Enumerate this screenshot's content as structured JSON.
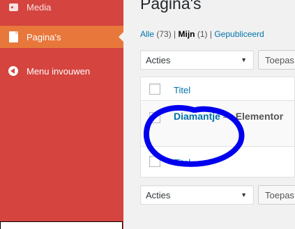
{
  "sidebar": {
    "items": [
      {
        "label": "Media",
        "icon": "media-icon"
      },
      {
        "label": "Pagina's",
        "icon": "page-icon",
        "active": true
      },
      {
        "label": "Menu invouwen",
        "icon": "collapse-icon"
      }
    ],
    "colors": {
      "background": "#d5443f",
      "active": "#e8773b"
    }
  },
  "main": {
    "heading": "Pagina's",
    "filters": {
      "all_label": "Alle",
      "all_count": "(73)",
      "mine_label": "Mijn",
      "mine_count": "(1)",
      "published_label": "Gepubliceerd",
      "separator": "|"
    },
    "bulk_actions": {
      "selected": "Acties",
      "apply_label": "Toepas"
    },
    "table": {
      "header_title": "Titel",
      "footer_title": "Titel",
      "rows": [
        {
          "title": "Diamantje",
          "separator": "—",
          "state": "Elementor"
        }
      ]
    }
  },
  "annotation": {
    "color": "#0000ee",
    "shape": "hand-drawn-circle"
  }
}
